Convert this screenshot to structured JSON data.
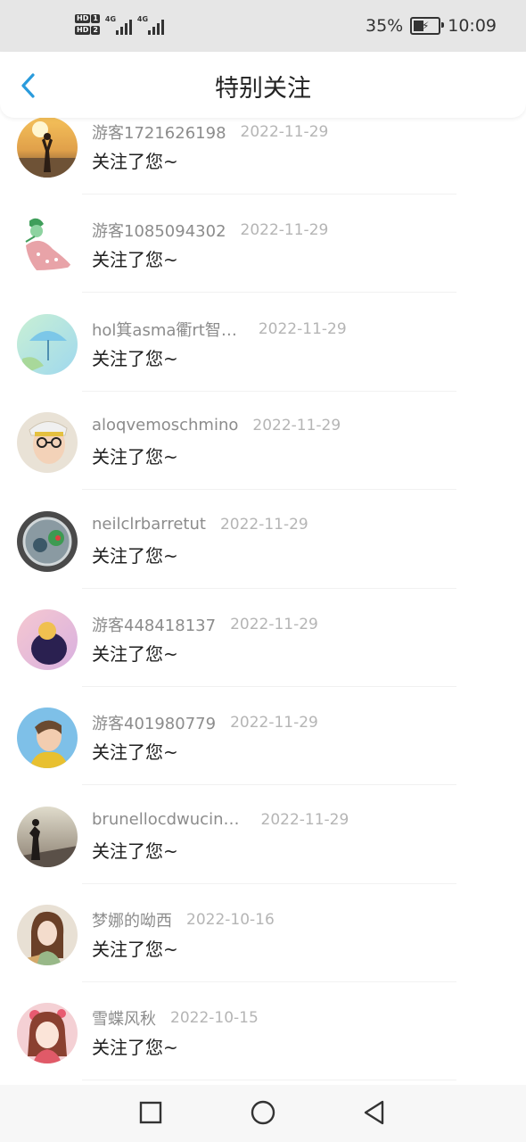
{
  "status_bar": {
    "hd1": "HD",
    "hd1_num": "1",
    "hd2": "HD",
    "hd2_num": "2",
    "sig1_type": "4G",
    "sig2_type": "4G",
    "battery_percent": "35%",
    "time": "10:09"
  },
  "header": {
    "title": "特别关注",
    "accent_color": "#2a9bdc"
  },
  "items": [
    {
      "username": "游客1721626198",
      "date": "2022-11-29",
      "message": "关注了您~"
    },
    {
      "username": "游客1085094302",
      "date": "2022-11-29",
      "message": "关注了您~"
    },
    {
      "username": "hol箕asma衢rt智…",
      "date": "2022-11-29",
      "message": "关注了您~"
    },
    {
      "username": "aloqvemoschmino",
      "date": "2022-11-29",
      "message": "关注了您~"
    },
    {
      "username": "neilclrbarretut",
      "date": "2022-11-29",
      "message": "关注了您~"
    },
    {
      "username": "游客448418137",
      "date": "2022-11-29",
      "message": "关注了您~"
    },
    {
      "username": "游客401980779",
      "date": "2022-11-29",
      "message": "关注了您~"
    },
    {
      "username": "brunellocdwucin…",
      "date": "2022-11-29",
      "message": "关注了您~"
    },
    {
      "username": "梦娜的呦西",
      "date": "2022-10-16",
      "message": "关注了您~"
    },
    {
      "username": "雪蝶风秋",
      "date": "2022-10-15",
      "message": "关注了您~"
    }
  ],
  "navbar": {
    "recent_icon": "square-icon",
    "home_icon": "circle-icon",
    "back_icon": "triangle-back-icon"
  }
}
